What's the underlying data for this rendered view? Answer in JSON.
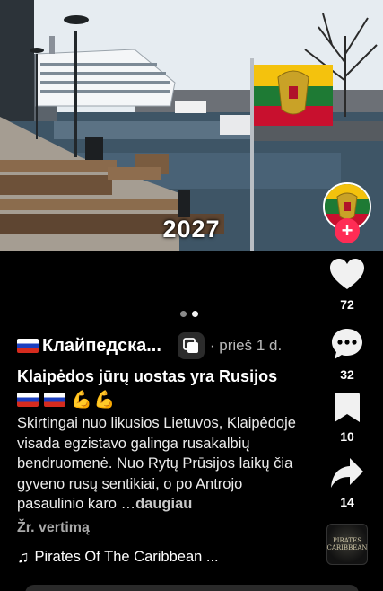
{
  "photo": {
    "caption": "2027",
    "flag_colors": {
      "yellow": "#f4c20d",
      "green": "#1e7a34",
      "red": "#c8102e"
    }
  },
  "pagination": {
    "total": 2,
    "active": 2
  },
  "actions": {
    "likes": "72",
    "comments": "32",
    "saves": "10",
    "shares": "14"
  },
  "post": {
    "author": "Клайпедска...",
    "time": "· prieš 1 d.",
    "title": "Klaipėdos jūrų uostas yra Rusijos",
    "body": "Skirtingai nuo likusios Lietuvos, Klaipėdoje visada egzistavo galinga rusakalbių bendruomenė. Nuo Rytų Prūsijos laikų čia gyveno rusų sentikiai, o po Antrojo pasaulinio karo …",
    "more_label": "daugiau",
    "translate_label": "Žr. vertimą",
    "music": "Pirates Of The Caribbean ..."
  },
  "disc": {
    "line1": "PIRATES",
    "line2": "CARIBBEAN"
  },
  "icons": [
    "heart-icon",
    "comment-icon",
    "bookmark-icon",
    "share-icon",
    "music-note-icon",
    "repost-icon"
  ],
  "accent": "#fe2c55"
}
